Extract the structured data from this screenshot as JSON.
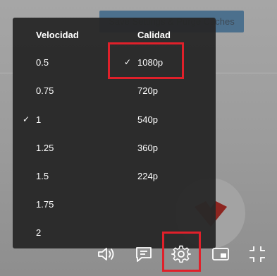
{
  "background": {
    "save_button_label": "Save Settings & Purge Caches"
  },
  "settings_menu": {
    "speed": {
      "heading": "Velocidad",
      "selected": "1",
      "options": [
        "0.5",
        "0.75",
        "1",
        "1.25",
        "1.5",
        "1.75",
        "2"
      ]
    },
    "quality": {
      "heading": "Calidad",
      "selected": "1080p",
      "options": [
        "1080p",
        "720p",
        "540p",
        "360p",
        "224p"
      ]
    },
    "check_glyph": "✓"
  },
  "controls": {
    "icons": [
      "volume-icon",
      "captions-icon",
      "settings-icon",
      "picture-in-picture-icon",
      "exit-fullscreen-icon"
    ]
  },
  "colors": {
    "menu_bg": "#282828",
    "highlight": "#e0202a",
    "save_button": "#2f5f86"
  }
}
